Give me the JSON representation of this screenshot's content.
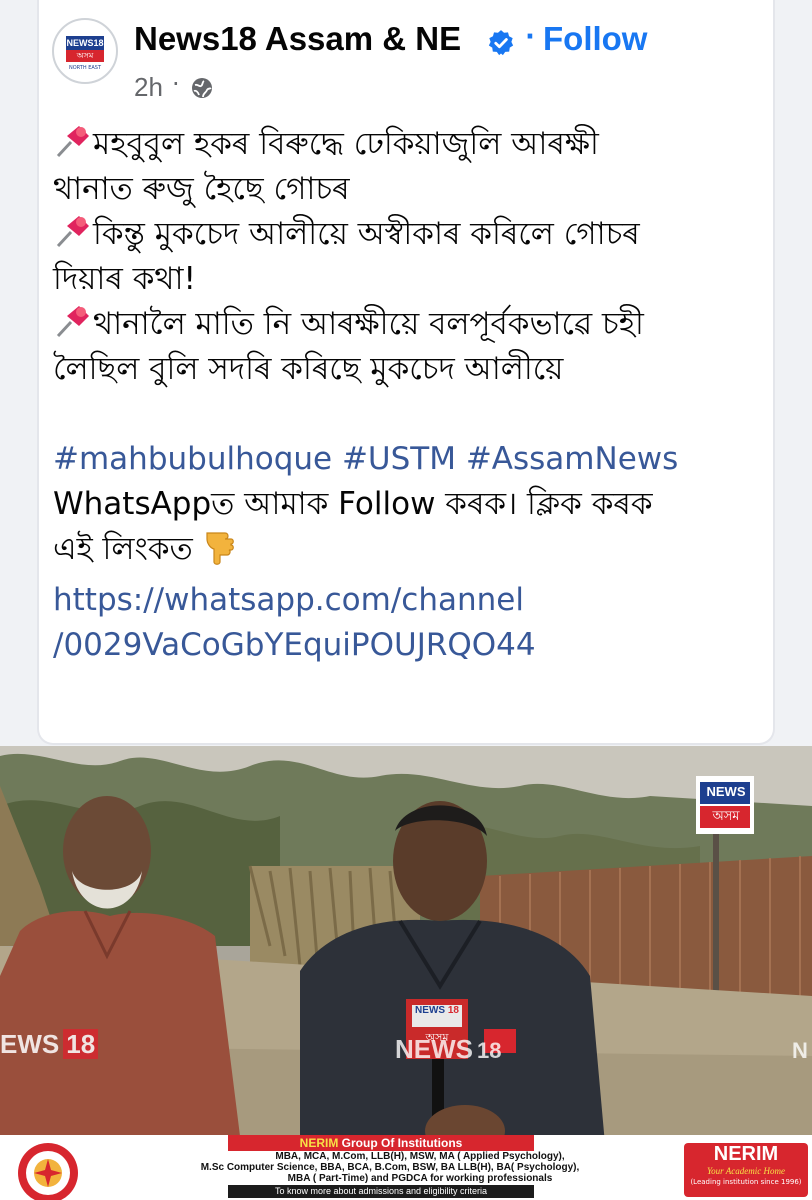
{
  "post": {
    "page_name": "News18 Assam & NE",
    "follow_label": "Follow",
    "separator": "·",
    "time": "2h",
    "time_dot": "·",
    "avatar_logo": {
      "top": "NEWS18",
      "mid": "অসম",
      "bottom": "NORTH EAST"
    },
    "lines": [
      "মহবুবুল হকৰ বিৰুদ্ধে ঢেকিয়াজুলি আৰক্ষী",
      "থানাত ৰুজু হৈছে গোচৰ",
      "কিন্তু মুকচেদ আলীয়ে অস্বীকাৰ কৰিলে গোচৰ",
      "দিয়াৰ কথা!",
      "থানালৈ মাতি নি আৰক্ষীয়ে বলপূৰ্বকভাৱে চহী",
      "লৈছিল বুলি সদৰি কৰিছে মুকচেদ আলীয়ে"
    ],
    "hashtags": "#mahbubulhoque #USTM #AssamNews",
    "whatsapp_line1": "WhatsAppত আমাক Follow কৰক। ক্লিক কৰক",
    "whatsapp_line2": "এই লিংকত",
    "link_line1": "https://whatsapp.com/channel",
    "link_line2": "/0029VaCoGbYEquiPOUJRQO44"
  },
  "video": {
    "logo_top": "NEWS",
    "logo_bottom": "অসম",
    "watermark_left": "EWS",
    "watermark_left_num": "18",
    "watermark_center": "NEWS",
    "watermark_center_num": "18",
    "mic_top": "NEWS",
    "mic_num": "18",
    "mic_bottom": "অসম",
    "watermark_right": "N"
  },
  "ad": {
    "brand": "NERIM",
    "group": "Group Of Institutions",
    "courses1": "MBA, MCA, M.Com, LLB(H), MSW, MA ( Applied Psychology),",
    "courses2": "M.Sc Computer Science, BBA, BCA, B.Com, BSW, BA LLB(H), BA( Psychology),",
    "courses3": "MBA ( Part-Time) and PGDCA for working professionals",
    "cta": "To know more about admissions and eligibility criteria",
    "right_brand": "NERIM",
    "right_tag": "Your Academic Home",
    "right_sub": "(Leading institution since 1996)"
  },
  "colors": {
    "accent": "#1877f2",
    "link": "#385898",
    "news_red": "#d7262e"
  }
}
